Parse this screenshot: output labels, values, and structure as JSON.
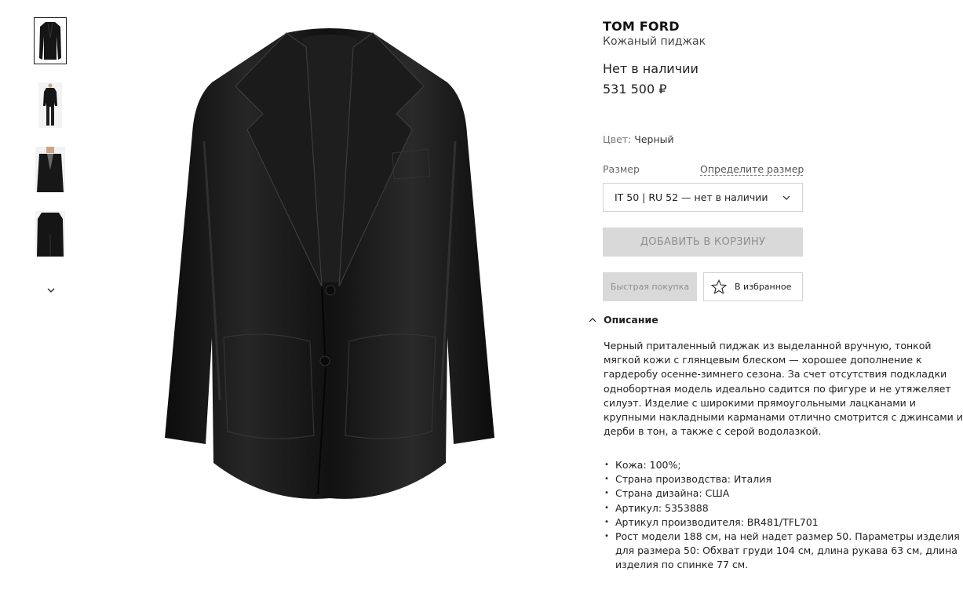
{
  "gallery": {
    "thumbnails": [
      {
        "label": "thumb-1",
        "variant": "front"
      },
      {
        "label": "thumb-2",
        "variant": "model-full"
      },
      {
        "label": "thumb-3",
        "variant": "model-close"
      },
      {
        "label": "thumb-4",
        "variant": "back"
      }
    ],
    "scroll_icon": "chevron-down-icon"
  },
  "product": {
    "brand": "TOM FORD",
    "name": "Кожаный пиджак",
    "availability": "Нет в наличии",
    "price": "531 500 ₽",
    "color_label": "Цвет:",
    "color_value": "Черный",
    "size_label": "Размер",
    "size_guide": "Определите размер",
    "size_selected": "IT 50 | RU 52 — нет в наличии",
    "add_to_cart": "ДОБАВИТЬ В КОРЗИНУ",
    "quick_buy": "Быстрая покупка",
    "favorite": "В избранное"
  },
  "description": {
    "title": "Описание",
    "text": "Черный приталенный пиджак из выделанной вручную, тонкой мягкой кожи с глянцевым блеском — хорошее дополнение к гардеробу осенне-зимнего сезона. За счет отсутствия подкладки однобортная модель идеально садится по фигуре и не утяжеляет силуэт. Изделие с широкими прямоугольными лацканами и крупными накладными карманами отлично смотрится с джинсами и дерби в тон, а также с серой водолазкой.",
    "specs": [
      "Кожа: 100%;",
      "Страна производства: Италия",
      "Страна дизайна: США",
      "Артикул: 5353888",
      "Артикул производителя: BR481/TFL701",
      "Рост модели 188 см, на ней надет размер 50. Параметры изделия для размера 50: Обхват груди 104 см, длина рукава 63 см, длина изделия по спинке 77 см."
    ]
  },
  "colors": {
    "disabled_bg": "#d9d9d9",
    "disabled_text": "#8f8f8f",
    "border": "#d3d3d3",
    "jacket": "#141414"
  }
}
